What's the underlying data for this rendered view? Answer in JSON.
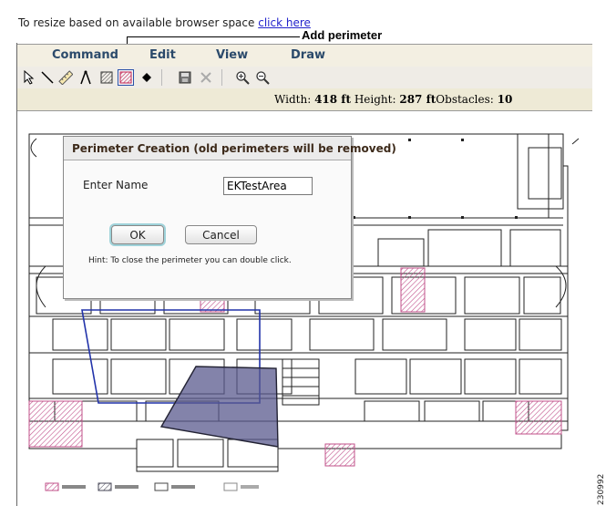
{
  "top_note": {
    "text": "To resize based on available browser space",
    "link": "click here"
  },
  "callout": {
    "label": "Add perimeter"
  },
  "menu": [
    {
      "label": "Command"
    },
    {
      "label": "Edit"
    },
    {
      "label": "View"
    },
    {
      "label": "Draw"
    }
  ],
  "toolbar": {
    "icons": [
      "select-arrow-icon",
      "line-icon",
      "ruler-icon",
      "compass-icon",
      "coverage-area-icon",
      "add-perimeter-icon",
      "location-diamond-icon",
      "save-disk-icon",
      "delete-x-icon",
      "zoom-in-icon",
      "zoom-out-icon"
    ],
    "active_icon": "add-perimeter-icon"
  },
  "status": {
    "width_label": "Width:",
    "width_value": "418 ft",
    "height_label": "Height:",
    "height_value": "287 ft",
    "obstacles_label": "Obstacles:",
    "obstacles_value": "10"
  },
  "dialog": {
    "title": "Perimeter Creation (old perimeters will be removed)",
    "name_label": "Enter Name",
    "name_value": "EKTestArea",
    "ok_label": "OK",
    "cancel_label": "Cancel",
    "hint": "Hint: To close the perimeter you can double click."
  },
  "figure_id": "230992",
  "colors": {
    "perimeter_fill": "#5a5a8e",
    "perimeter_line": "#2233aa",
    "hatch": "#c0508a",
    "menu_text": "#2b4a6b"
  }
}
